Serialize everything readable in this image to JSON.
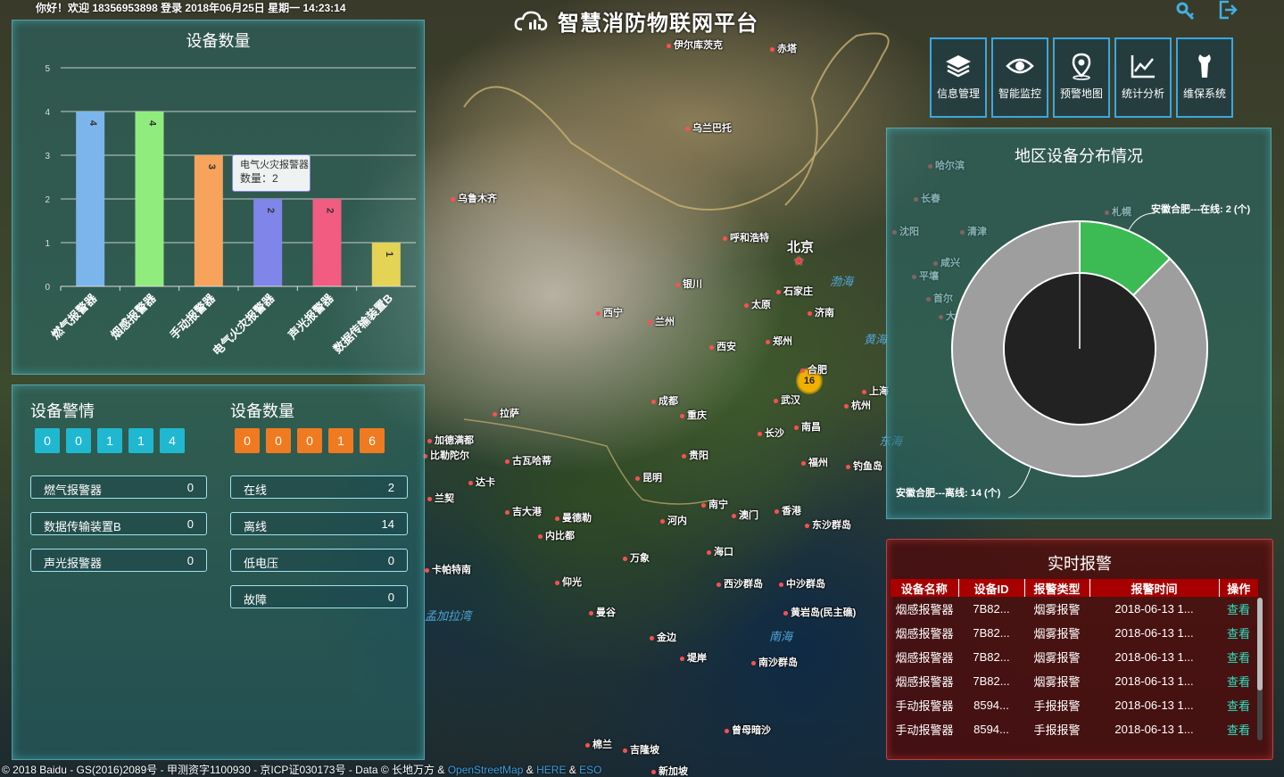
{
  "header": {
    "welcome": "你好！欢迎 18356953898 登录 2018年06月25日 星期一 14:23:14",
    "title": "智慧消防物联网平台"
  },
  "nav": [
    {
      "label": "信息管理",
      "icon": "layers-icon"
    },
    {
      "label": "智能监控",
      "icon": "eye-icon"
    },
    {
      "label": "预警地图",
      "icon": "map-pin-icon"
    },
    {
      "label": "统计分析",
      "icon": "line-chart-icon"
    },
    {
      "label": "维保系统",
      "icon": "wrench-icon"
    }
  ],
  "device_count_panel": {
    "title": "设备数量",
    "tooltip": {
      "name": "电气火灾报警器",
      "value_label": "数量：2"
    }
  },
  "chart_data": {
    "type": "bar",
    "title": "设备数量",
    "categories": [
      "燃气报警器",
      "烟感报警器",
      "手动报警器",
      "电气火灾报警器",
      "声光报警器",
      "数据传输装置B"
    ],
    "values": [
      4,
      4,
      3,
      2,
      2,
      1
    ],
    "colors": [
      "#7cb5ec",
      "#90ed7d",
      "#f7a35c",
      "#8085e9",
      "#f15c80",
      "#e4d354"
    ],
    "ylim": [
      0,
      5
    ],
    "yticks": [
      0,
      1,
      2,
      3,
      4,
      5
    ],
    "grid": true
  },
  "alerts_panel": {
    "title": "设备警情",
    "digits": [
      "0",
      "0",
      "1",
      "1",
      "4"
    ],
    "rows": [
      {
        "label": "燃气报警器",
        "value": "0"
      },
      {
        "label": "数据传输装置B",
        "value": "0"
      },
      {
        "label": "声光报警器",
        "value": "0"
      }
    ]
  },
  "status_panel": {
    "title": "设备数量",
    "digits": [
      "0",
      "0",
      "0",
      "1",
      "6"
    ],
    "rows": [
      {
        "label": "在线",
        "value": "2"
      },
      {
        "label": "离线",
        "value": "14"
      },
      {
        "label": "低电压",
        "value": "0"
      },
      {
        "label": "故障",
        "value": "0"
      }
    ]
  },
  "region_panel": {
    "title": "地区设备分布情况",
    "pie": {
      "type": "pie",
      "slices": [
        {
          "label": "安徽合肥---在线: 2 (个)",
          "value": 2,
          "color": "#3cba54"
        },
        {
          "label": "安徽合肥---离线: 14 (个)",
          "value": 14,
          "color": "#9e9e9e"
        }
      ]
    }
  },
  "alarm_panel": {
    "title": "实时报警",
    "columns": [
      "设备名称",
      "设备ID",
      "报警类型",
      "报警时间",
      "操作"
    ],
    "rows": [
      [
        "烟感报警器",
        "7B82...",
        "烟雾报警",
        "2018-06-13 1...",
        "查看"
      ],
      [
        "烟感报警器",
        "7B82...",
        "烟雾报警",
        "2018-06-13 1...",
        "查看"
      ],
      [
        "烟感报警器",
        "7B82...",
        "烟雾报警",
        "2018-06-13 1...",
        "查看"
      ],
      [
        "烟感报警器",
        "7B82...",
        "烟雾报警",
        "2018-06-13 1...",
        "查看"
      ],
      [
        "手动报警器",
        "8594...",
        "手报报警",
        "2018-06-13 1...",
        "查看"
      ],
      [
        "手动报警器",
        "8594...",
        "手报报警",
        "2018-06-13 1...",
        "查看"
      ]
    ]
  },
  "map": {
    "cluster_count": "16",
    "labels": [
      "伊尔库茨克",
      "赤塔",
      "乌兰巴托",
      "乌鲁木齐",
      "呼和浩特",
      "北京",
      "银川",
      "石家庄",
      "西宁",
      "兰州",
      "太原",
      "济南",
      "郑州",
      "西安",
      "合肥",
      "武汉",
      "上海",
      "杭州",
      "拉萨",
      "成都",
      "重庆",
      "长沙",
      "南昌",
      "贵阳",
      "福州",
      "钓鱼岛",
      "加德满都",
      "比勒陀尔",
      "古瓦哈蒂",
      "达卡",
      "昆明",
      "南宁",
      "澳门",
      "香港",
      "东沙群岛",
      "吉大港",
      "曼德勒",
      "河内",
      "内比都",
      "海口",
      "万象",
      "仰光",
      "西沙群岛",
      "中沙群岛",
      "黄岩岛(民主礁)",
      "曼谷",
      "金边",
      "堤岸",
      "南沙群岛",
      "曾母暗沙",
      "棉兰",
      "吉隆坡",
      "新加坡",
      "哈尔滨",
      "长春",
      "沈阳",
      "清津",
      "札幌",
      "咸兴",
      "平壤",
      "首尔",
      "大",
      "兰契",
      "卡帕特南"
    ],
    "seas": [
      "渤海",
      "黄海",
      "东海",
      "南海",
      "孟加拉湾"
    ],
    "attribution": "© 2018 Baidu - GS(2016)2089号 - 甲测资字1100930 - 京ICP证030173号 - Data © 长地万方 &",
    "attribution_links": [
      "OpenStreetMap",
      "HERE",
      "ESO"
    ],
    "attribution_amp": "&"
  }
}
